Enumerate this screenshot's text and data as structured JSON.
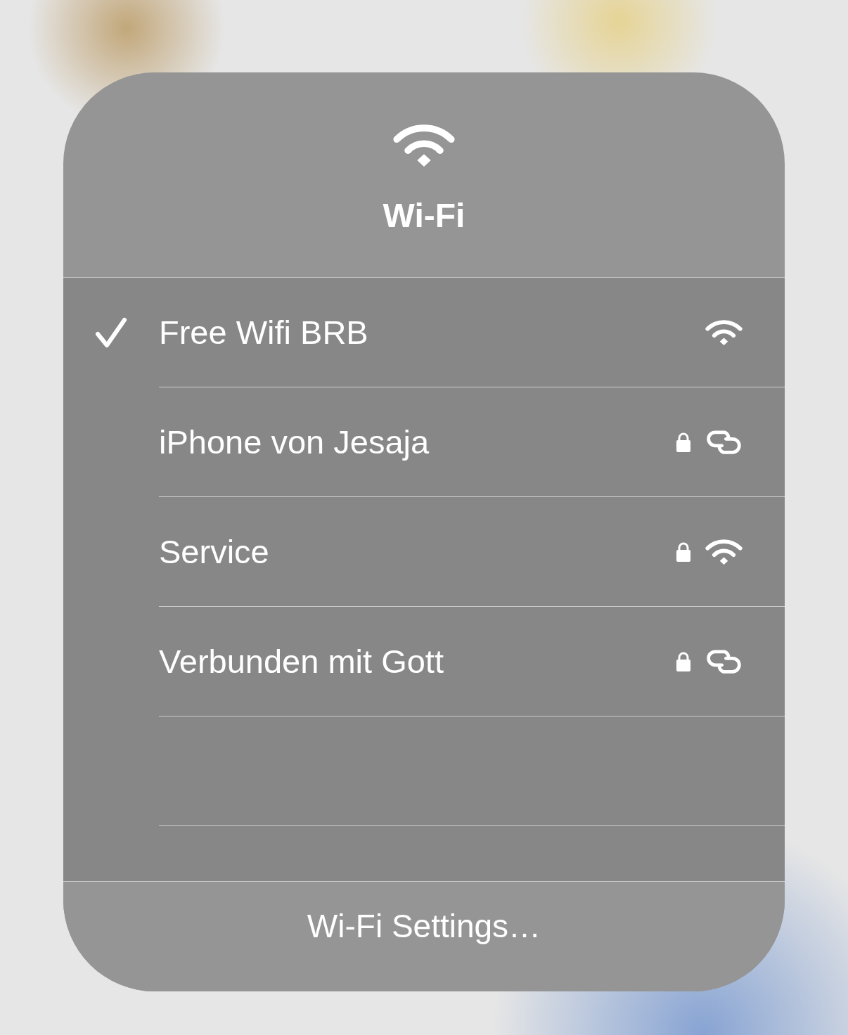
{
  "panel": {
    "title": "Wi-Fi"
  },
  "networks": [
    {
      "name": "Free Wifi BRB",
      "selected": true,
      "locked": false,
      "kind": "wifi"
    },
    {
      "name": "iPhone von Jesaja",
      "selected": false,
      "locked": true,
      "kind": "hotspot"
    },
    {
      "name": "Service",
      "selected": false,
      "locked": true,
      "kind": "wifi"
    },
    {
      "name": "Verbunden mit Gott",
      "selected": false,
      "locked": true,
      "kind": "hotspot"
    }
  ],
  "footer": {
    "link": "Wi-Fi Settings…"
  }
}
